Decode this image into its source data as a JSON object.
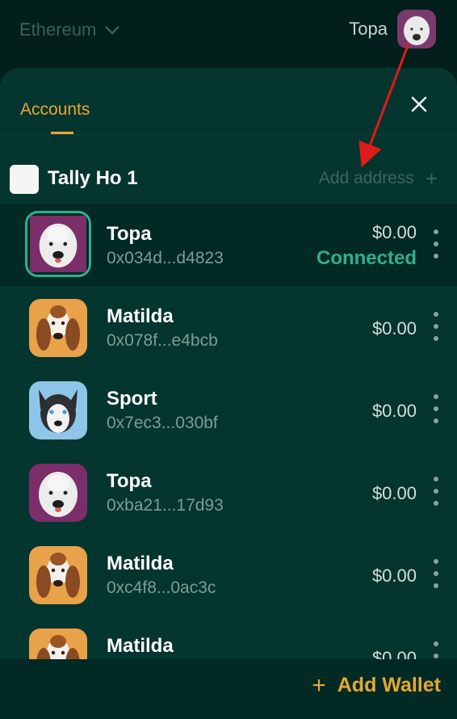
{
  "topbar": {
    "network": "Ethereum",
    "account_name": "Topa"
  },
  "tabs": {
    "accounts": "Accounts"
  },
  "wallet": {
    "name": "Tally Ho 1",
    "add_address": "Add address",
    "add_address_icon": "+"
  },
  "accounts": [
    {
      "name": "Topa",
      "address": "0x034d...d4823",
      "balance": "$0.00",
      "status": "Connected",
      "avatar": "white-dog"
    },
    {
      "name": "Matilda",
      "address": "0x078f...e4bcb",
      "balance": "$0.00",
      "avatar": "basset-dog"
    },
    {
      "name": "Sport",
      "address": "0x7ec3...030bf",
      "balance": "$0.00",
      "avatar": "husky-dog"
    },
    {
      "name": "Topa",
      "address": "0xba21...17d93",
      "balance": "$0.00",
      "avatar": "white-dog"
    },
    {
      "name": "Matilda",
      "address": "0xc4f8...0ac3c",
      "balance": "$0.00",
      "avatar": "basset-dog"
    },
    {
      "name": "Matilda",
      "address": "",
      "balance": "$0.00",
      "avatar": "basset-dog"
    }
  ],
  "footer": {
    "add_wallet_icon": "+",
    "add_wallet": "Add Wallet"
  },
  "colors": {
    "accent": "#e6a637",
    "connected": "#2fb08a",
    "panel": "#04352e",
    "annotation_arrow": "#e01b1b"
  }
}
